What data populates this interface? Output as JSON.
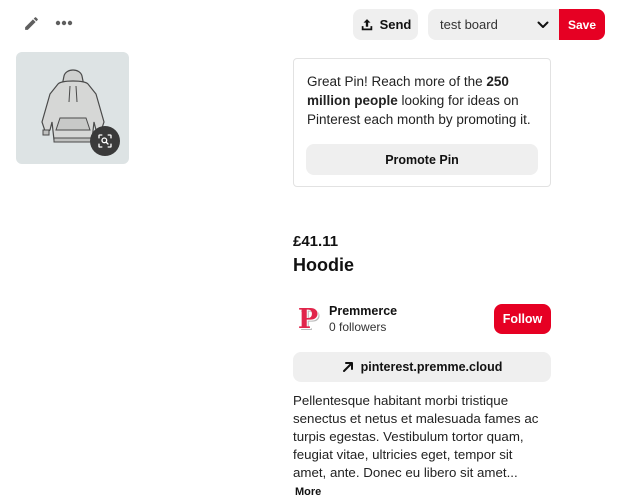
{
  "toolbar": {
    "edit_icon": "pencil-icon",
    "more_icon": "ellipsis-icon",
    "send_label": "Send",
    "send_icon": "share-upload-icon",
    "board_selected": "test board",
    "save_label": "Save"
  },
  "pin": {
    "image_subject": "grey hoodie",
    "lens_icon": "visual-search-icon"
  },
  "promote": {
    "text_before": "Great Pin! Reach more of the ",
    "text_bold": "250 million people",
    "text_after": " looking for ideas on Pinterest each month by promoting it.",
    "button_label": "Promote Pin"
  },
  "product": {
    "price": "£41.11",
    "title": "Hoodie"
  },
  "creator": {
    "avatar_letter": "P",
    "name": "Premmerce",
    "followers": "0 followers",
    "follow_label": "Follow"
  },
  "link": {
    "icon": "arrow-up-right-icon",
    "label": "pinterest.premme.cloud"
  },
  "description": {
    "text": "Pellentesque habitant morbi tristique senectus et netus et malesuada fames ac turpis egestas. Vestibulum tortor quam, feugiat vitae, ultricies eget, tempor sit amet, ante. Donec eu libero sit amet...",
    "more_label": "More"
  },
  "colors": {
    "brand_red": "#e60023",
    "button_grey": "#efefef",
    "image_bg": "#dde3e4"
  }
}
